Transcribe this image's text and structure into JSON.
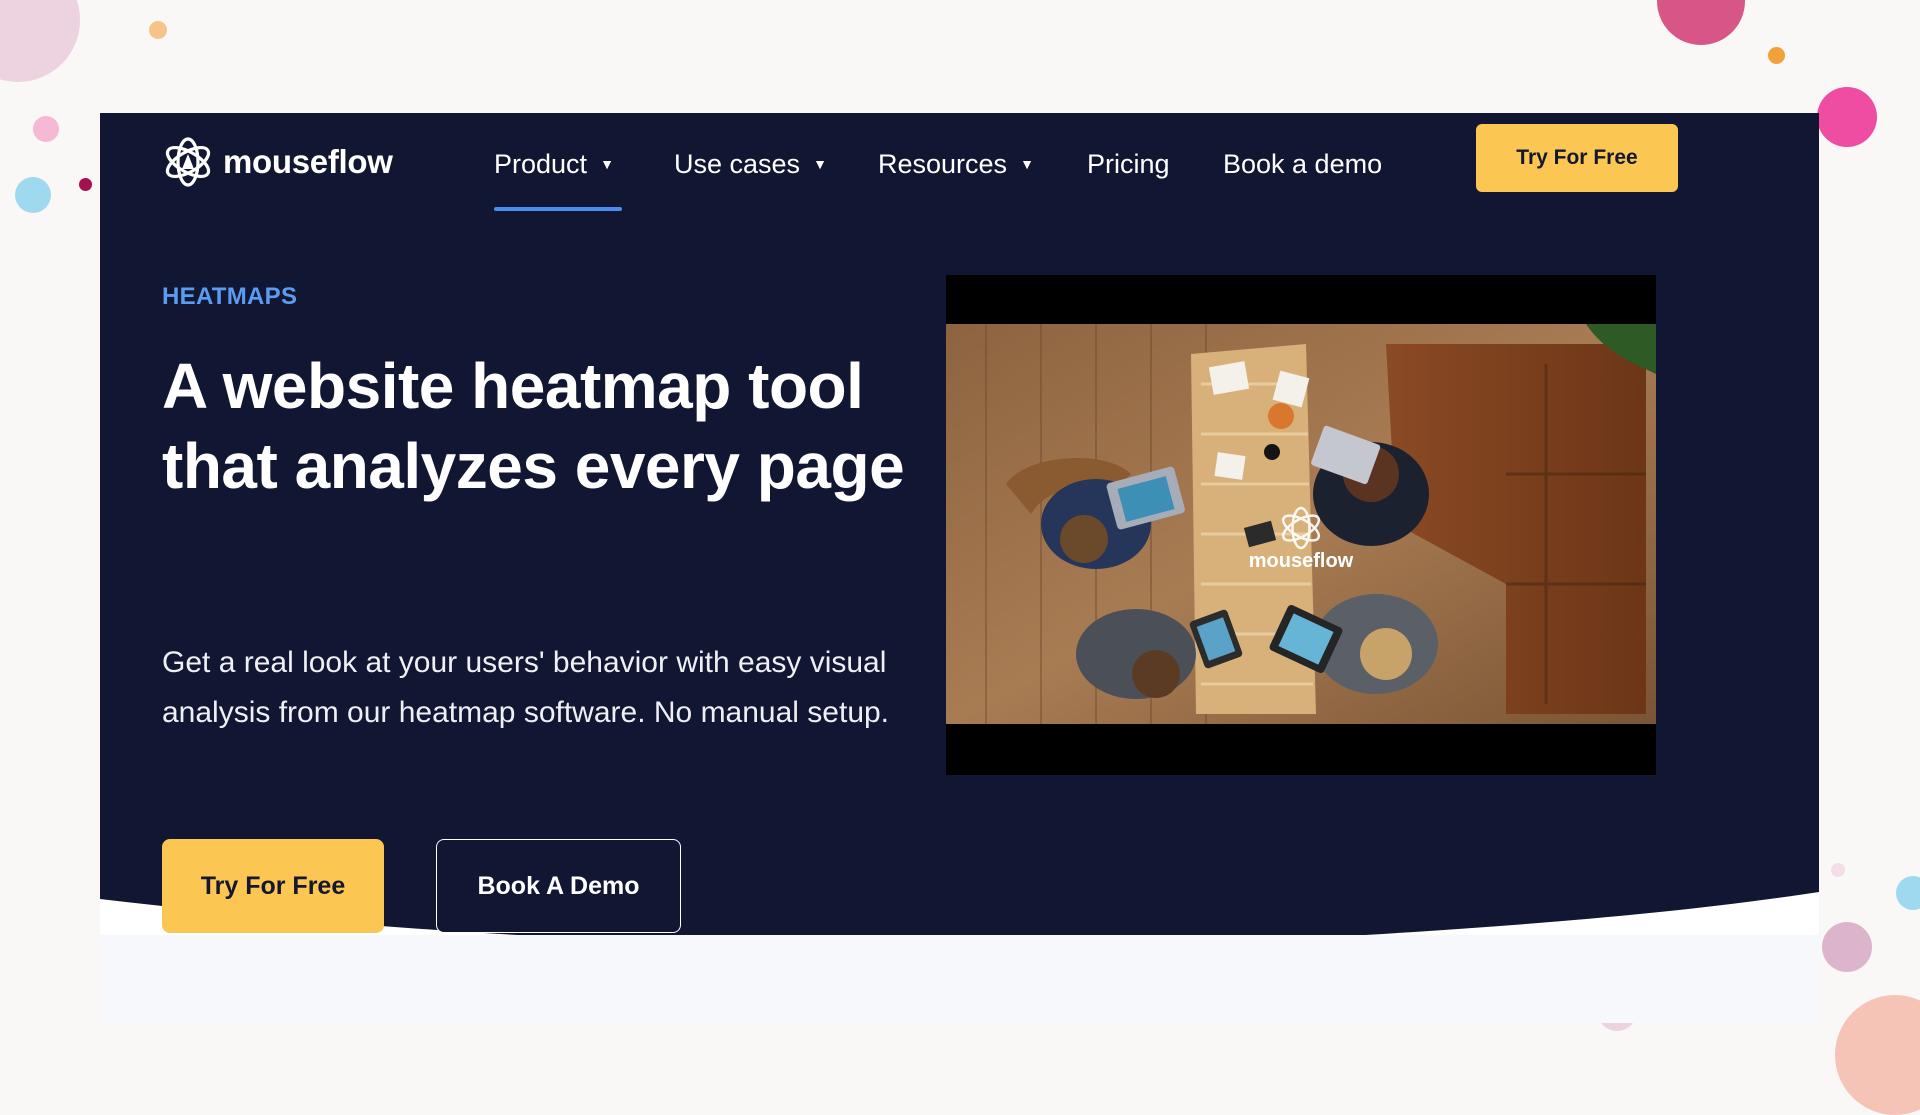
{
  "brand": {
    "name": "mouseflow"
  },
  "nav": {
    "items": [
      {
        "label": "Product",
        "has_dropdown": true,
        "active": true
      },
      {
        "label": "Use cases",
        "has_dropdown": true,
        "active": false
      },
      {
        "label": "Resources",
        "has_dropdown": true,
        "active": false
      },
      {
        "label": "Pricing",
        "has_dropdown": false,
        "active": false
      },
      {
        "label": "Book a demo",
        "has_dropdown": false,
        "active": false
      }
    ],
    "dropdown_glyph": "▼",
    "cta_label": "Try For Free"
  },
  "hero": {
    "eyebrow": "HEATMAPS",
    "headline": "A website heatmap tool that analyzes every page",
    "lede": "Get a real look at your users' behavior with easy visual analysis from our heatmap software. No manual setup.",
    "primary_cta": "Try For Free",
    "secondary_cta": "Book A Demo"
  },
  "video": {
    "watermark": "mouseflow"
  },
  "colors": {
    "background": "#faf8f6",
    "navy": "#111732",
    "accent_yellow": "#fcc653",
    "link_blue": "#5b9bf2",
    "lower_panel": "#f7f8fb"
  },
  "icons": {
    "logo": "atom-logo-icon",
    "dropdown": "caret-down-icon"
  }
}
